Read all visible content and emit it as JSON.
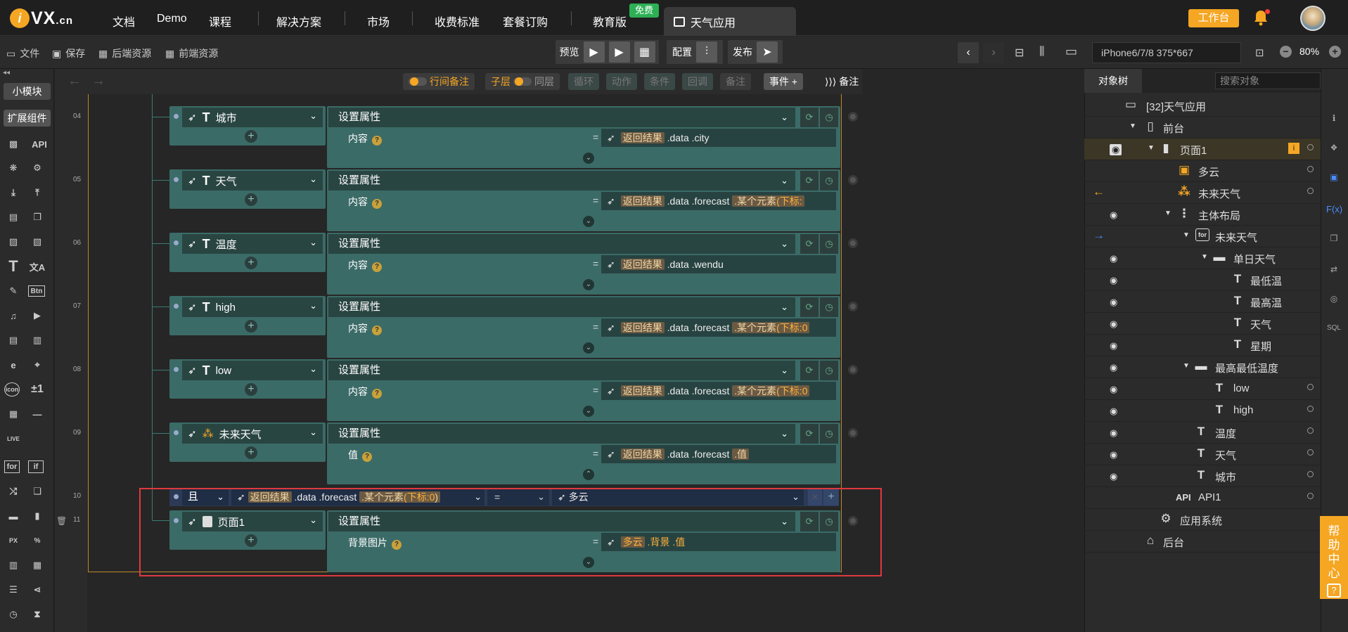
{
  "nav": {
    "logo_text": "VX",
    "logo_suffix": ".cn",
    "items": [
      "文档",
      "Demo",
      "课程",
      "解决方案",
      "市场",
      "收费标准",
      "套餐订购",
      "教育版"
    ],
    "free_badge": "免费",
    "app_tab": "天气应用",
    "workbench": "工作台"
  },
  "toolbar": {
    "file": "文件",
    "save": "保存",
    "backend": "后端资源",
    "frontend": "前端资源",
    "preview": "预览",
    "config": "配置",
    "publish": "发布",
    "device": "iPhone6/7/8 375*667",
    "zoom": "80%"
  },
  "left": {
    "small_module": "小模块",
    "ext_comp": "扩展组件",
    "api": "API",
    "btn": "Btn",
    "icon": "icon",
    "pm": "±1",
    "for": "for",
    "if": "if",
    "px": "PX",
    "pct": "%"
  },
  "editor_toolbar": {
    "inline_note": "行间备注",
    "child_layer": "子层",
    "same_layer": "同层",
    "loop": "循环",
    "action": "动作",
    "condition": "条件",
    "callback": "回调",
    "note": "备注",
    "event": "事件",
    "note2": "备注"
  },
  "linenos": [
    "04",
    "05",
    "06",
    "07",
    "08",
    "09",
    "10",
    "11"
  ],
  "rows": [
    {
      "target": "城市",
      "action": "设置属性",
      "prop": "内容",
      "value_prefix": "返回结果",
      "value_path": ".data",
      ".v": "",
      "tail": ".city",
      "tail_token": ".city"
    },
    {
      "target": "天气",
      "action": "设置属性",
      "prop": "内容",
      "tail": ".forecast",
      "extra": ".某个元素",
      "index": "(下标:"
    },
    {
      "target": "温度",
      "action": "设置属性",
      "prop": "内容",
      "tail": ".wendu"
    },
    {
      "target": "high",
      "action": "设置属性",
      "prop": "内容",
      "tail": ".forecast",
      "extra": ".某个元素",
      "index": "(下标:0"
    },
    {
      "target": "low",
      "action": "设置属性",
      "prop": "内容",
      "tail": ".forecast",
      "extra": ".某个元素",
      "index": "(下标:0"
    },
    {
      "target": "未来天气",
      "action": "设置属性",
      "prop": "值",
      "tail": ".forecast",
      "extra": ".值"
    }
  ],
  "cond": {
    "and": "且",
    "expr_a": "返回结果",
    "expr_b": ".data",
    "expr_c": ".forecast",
    "expr_d": ".某个元素",
    "expr_idx": "(下标:0",
    "expr_close": ")",
    "op": "=",
    "rhs": "多云"
  },
  "row11": {
    "target": "页面1",
    "action": "设置属性",
    "prop": "背景图片",
    "v1": "多云",
    "v2": ".背景",
    "v3": ".值"
  },
  "value_prefix": "返回结果",
  "data_path": ".data",
  "eq": "=",
  "right": {
    "tab": "对象树",
    "search": "搜索对象",
    "tree": [
      {
        "label": "[32]天气应用"
      },
      {
        "label": "前台"
      },
      {
        "label": "页面1"
      },
      {
        "label": "多云"
      },
      {
        "label": "未来天气"
      },
      {
        "label": "主体布局"
      },
      {
        "label": "未来天气"
      },
      {
        "label": "单日天气"
      },
      {
        "label": "最低温"
      },
      {
        "label": "最高温"
      },
      {
        "label": "天气"
      },
      {
        "label": "星期"
      },
      {
        "label": "最高最低温度"
      },
      {
        "label": "low"
      },
      {
        "label": "high"
      },
      {
        "label": "温度"
      },
      {
        "label": "天气"
      },
      {
        "label": "城市"
      },
      {
        "label": "API1"
      },
      {
        "label": "应用系统"
      },
      {
        "label": "后台"
      }
    ],
    "api_prefix": "API"
  },
  "help": "帮助中心"
}
